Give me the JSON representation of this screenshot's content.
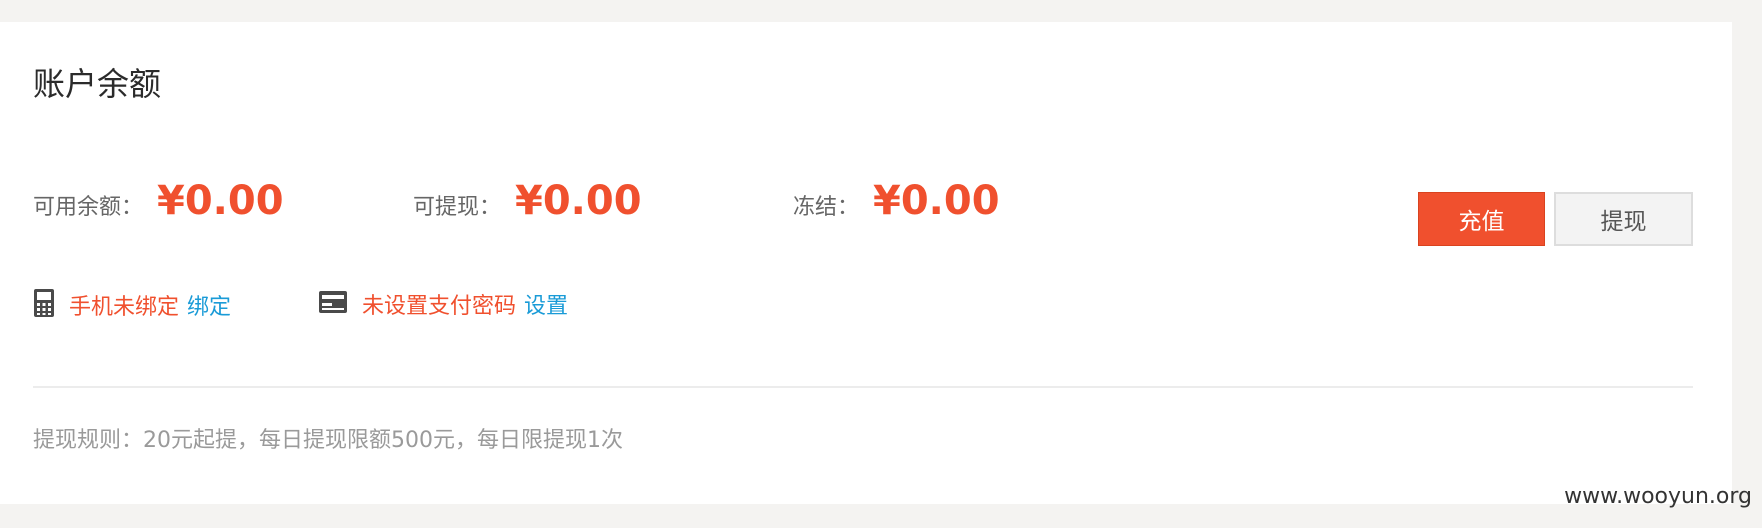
{
  "title": "账户余额",
  "balances": [
    {
      "label": "可用余额：",
      "amount": "¥0.00"
    },
    {
      "label": "可提现：",
      "amount": "¥0.00"
    },
    {
      "label": "冻结：",
      "amount": "¥0.00"
    }
  ],
  "buttons": {
    "recharge": "充值",
    "withdraw": "提现"
  },
  "notices": {
    "phone": {
      "icon": "mobile-phone-icon",
      "text": "手机未绑定",
      "link": "绑定"
    },
    "password": {
      "icon": "card-icon",
      "text": "未设置支付密码",
      "link": "设置"
    }
  },
  "rules": "提现规则：20元起提，每日提现限额500元，每日限提现1次",
  "watermark": "www.wooyun.org",
  "colors": {
    "accent": "#f0502e",
    "link": "#1a9bd7",
    "background": "#f4f3f1"
  }
}
